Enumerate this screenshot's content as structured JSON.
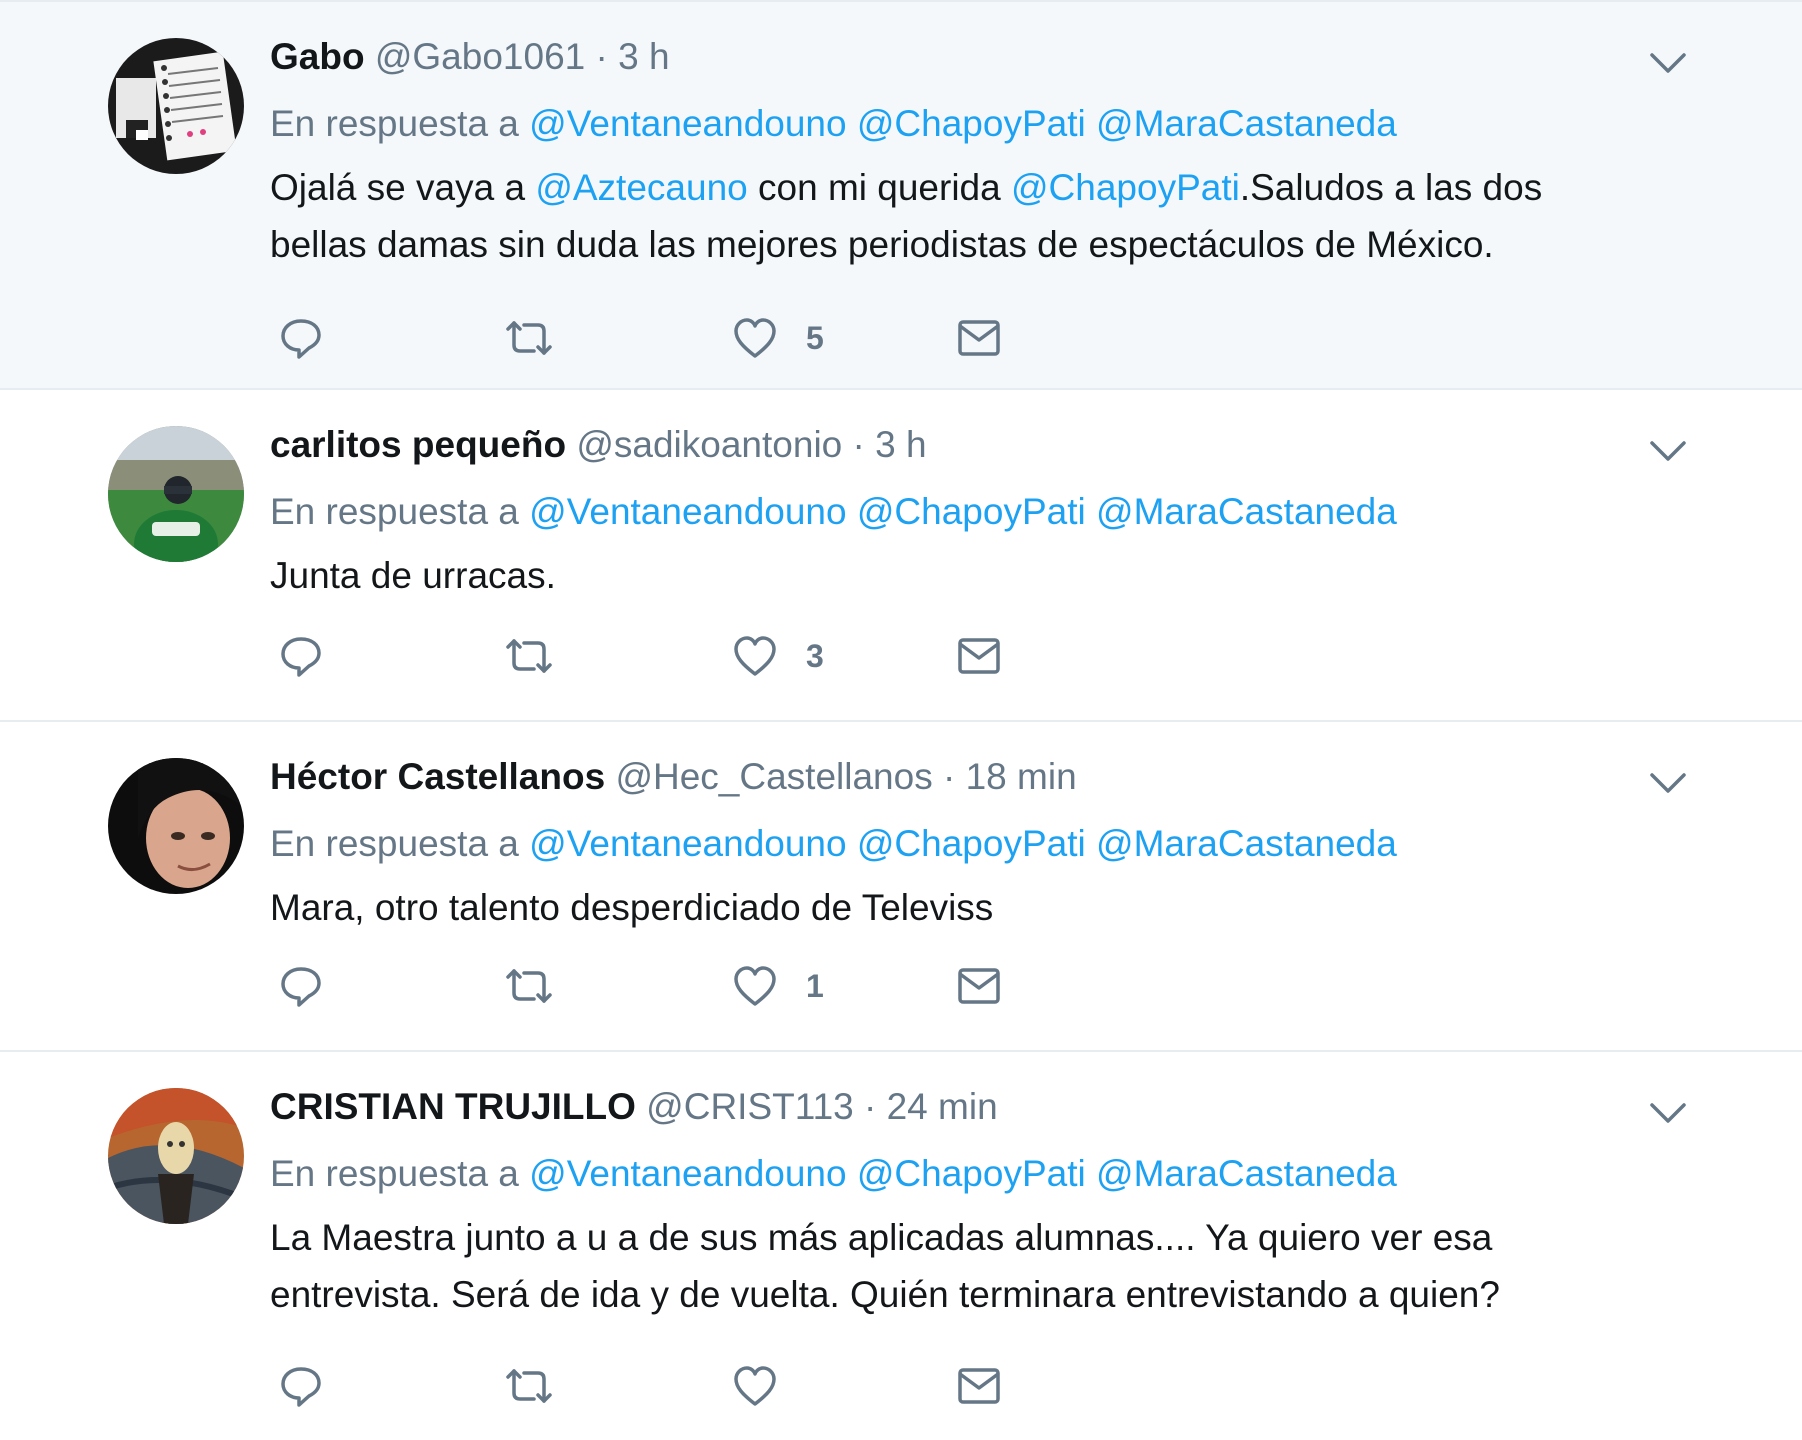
{
  "reply_prefix": "En respuesta a",
  "tweets": [
    {
      "name": "Gabo",
      "handle": "@Gabo1061",
      "separator": "·",
      "time": "3 h",
      "reply_to": [
        "@Ventaneandouno",
        "@ChapoyPati",
        "@MaraCastaneda"
      ],
      "text_parts": [
        {
          "text": "Ojalá se vaya a ",
          "mention": false
        },
        {
          "text": "@Aztecauno",
          "mention": true
        },
        {
          "text": " con mi querida ",
          "mention": false
        },
        {
          "text": "@ChapoyPati",
          "mention": true
        },
        {
          "text": ".Saludos a las dos\nbellas damas sin duda las mejores periodistas de espectáculos de México.",
          "mention": false
        }
      ],
      "like_count": "5",
      "highlighted": true,
      "avatar_icon": "notebook-photo-avatar"
    },
    {
      "name": "carlitos pequeño",
      "handle": "@sadikoantonio",
      "separator": "·",
      "time": "3 h",
      "reply_to": [
        "@Ventaneandouno",
        "@ChapoyPati",
        "@MaraCastaneda"
      ],
      "text_parts": [
        {
          "text": "Junta de urracas.",
          "mention": false
        }
      ],
      "like_count": "3",
      "highlighted": false,
      "avatar_icon": "stadium-photo-avatar"
    },
    {
      "name": "Héctor Castellanos",
      "handle": "@Hec_Castellanos",
      "separator": "·",
      "time": "18 min",
      "reply_to": [
        "@Ventaneandouno",
        "@ChapoyPati",
        "@MaraCastaneda"
      ],
      "text_parts": [
        {
          "text": "Mara, otro talento desperdiciado de Televiss",
          "mention": false
        }
      ],
      "like_count": "1",
      "highlighted": false,
      "avatar_icon": "face-photo-avatar"
    },
    {
      "name": "CRISTIAN TRUJILLO",
      "handle": "@CRIST113",
      "separator": "·",
      "time": "24 min",
      "reply_to": [
        "@Ventaneandouno",
        "@ChapoyPati",
        "@MaraCastaneda"
      ],
      "text_parts": [
        {
          "text": "La Maestra junto a u a de sus más aplicadas alumnas.... Ya quiero ver esa\nentrevista. Será de ida y de vuelta. Quién terminara entrevistando a quien?",
          "mention": false
        }
      ],
      "like_count": "",
      "highlighted": false,
      "avatar_icon": "painting-photo-avatar"
    }
  ],
  "colors": {
    "text": "#14171a",
    "muted": "#657786",
    "link": "#1da1f2",
    "highlight_bg": "#f5f8fa",
    "divider": "#e6ecf0"
  },
  "icons": {
    "reply": "reply-icon",
    "retweet": "retweet-icon",
    "like": "heart-icon",
    "dm": "envelope-icon",
    "caret": "chevron-down-icon"
  }
}
